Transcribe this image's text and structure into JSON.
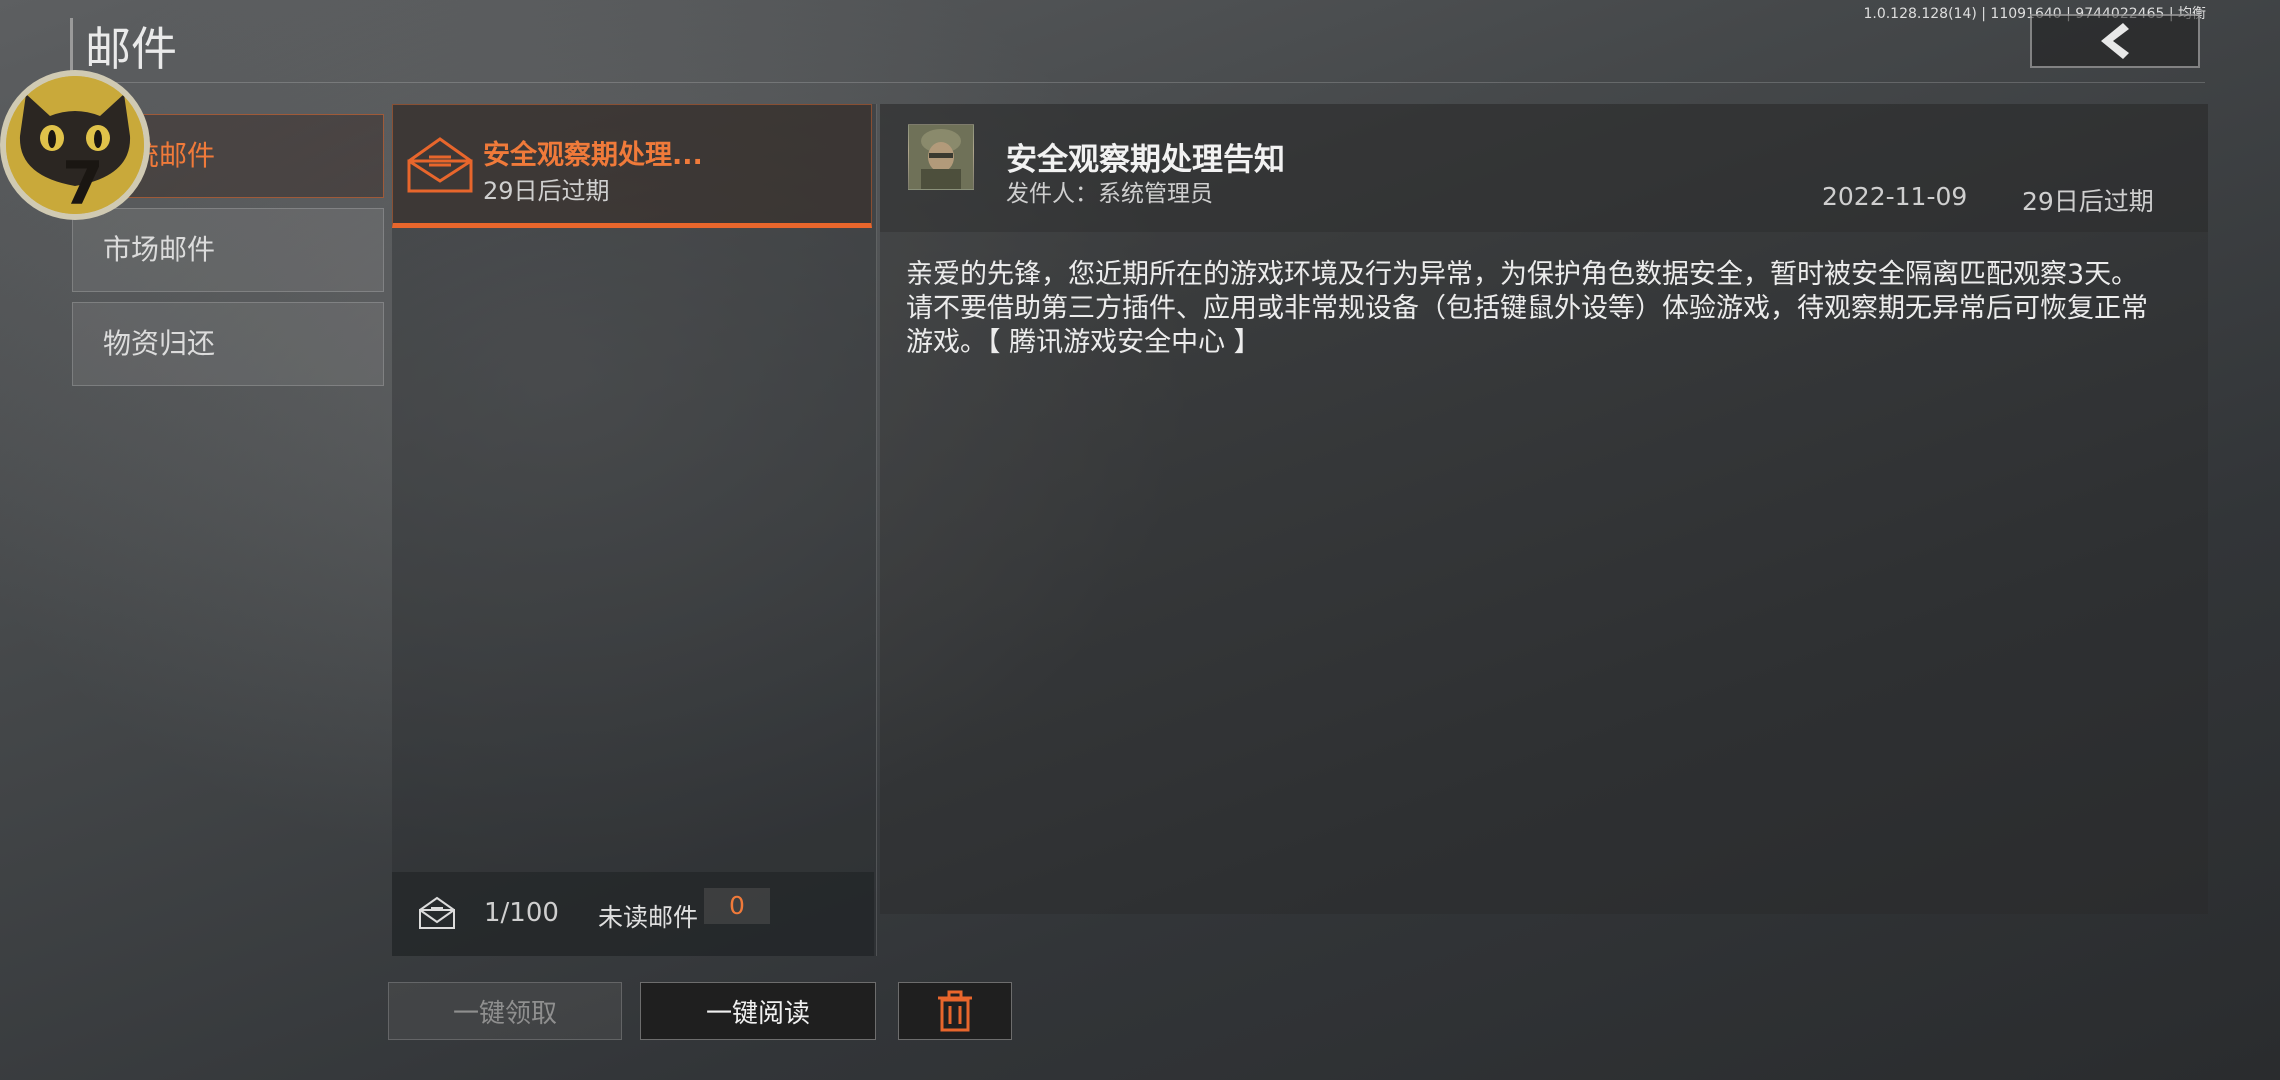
{
  "header": {
    "title": "邮件",
    "version_info": "1.0.128.128(14) | 11091640 | 9744022465 | 均衡"
  },
  "tabs": [
    {
      "label": "系统邮件",
      "active": true
    },
    {
      "label": "市场邮件",
      "active": false
    },
    {
      "label": "物资归还",
      "active": false
    }
  ],
  "mail_list": {
    "items": [
      {
        "title": "安全观察期处理...",
        "expire": "29日后过期"
      }
    ],
    "footer": {
      "count": "1/100",
      "unread_label": "未读邮件",
      "unread_count": "0"
    }
  },
  "buttons": {
    "claim_all": "一键领取",
    "read_all": "一键阅读",
    "delete_icon": "trash-icon"
  },
  "detail": {
    "title": "安全观察期处理告知",
    "sender": "发件人：系统管理员",
    "date": "2022-11-09",
    "expire": "29日后过期",
    "body": "亲爱的先锋，您近期所在的游戏环境及行为异常，为保护角色数据安全，暂时被安全隔离匹配观察3天。请不要借助第三方插件、应用或非常规设备（包括键鼠外设等）体验游戏，待观察期无异常后可恢复正常游戏。【 腾讯游戏安全中心 】"
  },
  "colors": {
    "accent": "#e8662c",
    "accent_text": "#f07a3a"
  }
}
